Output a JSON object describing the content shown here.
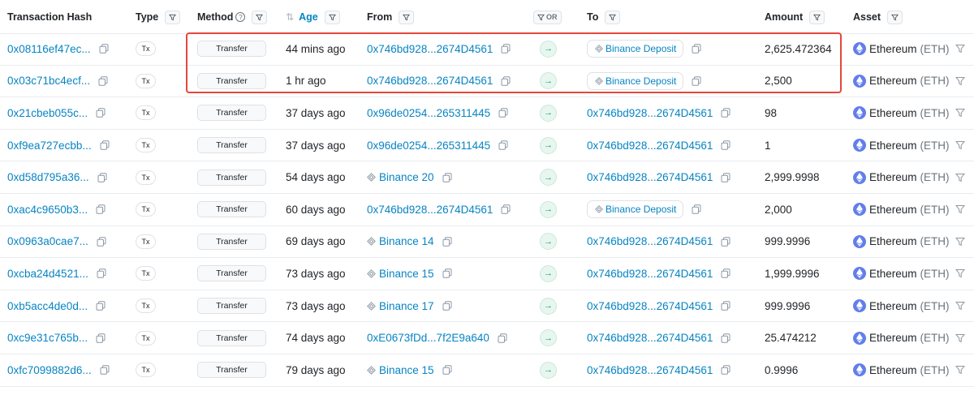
{
  "headers": {
    "hash": "Transaction Hash",
    "type": "Type",
    "method": "Method",
    "age": "Age",
    "from": "From",
    "or": "OR",
    "to": "To",
    "amount": "Amount",
    "asset": "Asset"
  },
  "colors": {
    "link": "#0784c3",
    "highlight_border": "#e5473b",
    "direction_badge": "#00a186",
    "eth": "#627eea"
  },
  "rows": [
    {
      "hash": "0x08116ef47ec...",
      "type": "Tx",
      "method": "Transfer",
      "age": "44 mins ago",
      "from": "0x746bd928...2674D4561",
      "from_kind": "address",
      "to": "Binance Deposit",
      "to_kind": "deposit",
      "amount": "2,625.472364",
      "asset_name": "Ethereum",
      "asset_symbol": "(ETH)"
    },
    {
      "hash": "0x03c71bc4ecf...",
      "type": "Tx",
      "method": "Transfer",
      "age": "1 hr ago",
      "from": "0x746bd928...2674D4561",
      "from_kind": "address",
      "to": "Binance Deposit",
      "to_kind": "deposit",
      "amount": "2,500",
      "asset_name": "Ethereum",
      "asset_symbol": "(ETH)"
    },
    {
      "hash": "0x21cbeb055c...",
      "type": "Tx",
      "method": "Transfer",
      "age": "37 days ago",
      "from": "0x96de0254...265311445",
      "from_kind": "address",
      "to": "0x746bd928...2674D4561",
      "to_kind": "address",
      "amount": "98",
      "asset_name": "Ethereum",
      "asset_symbol": "(ETH)"
    },
    {
      "hash": "0xf9ea727ecbb...",
      "type": "Tx",
      "method": "Transfer",
      "age": "37 days ago",
      "from": "0x96de0254...265311445",
      "from_kind": "address",
      "to": "0x746bd928...2674D4561",
      "to_kind": "address",
      "amount": "1",
      "asset_name": "Ethereum",
      "asset_symbol": "(ETH)"
    },
    {
      "hash": "0xd58d795a36...",
      "type": "Tx",
      "method": "Transfer",
      "age": "54 days ago",
      "from": "Binance 20",
      "from_kind": "entity",
      "to": "0x746bd928...2674D4561",
      "to_kind": "address",
      "amount": "2,999.9998",
      "asset_name": "Ethereum",
      "asset_symbol": "(ETH)"
    },
    {
      "hash": "0xac4c9650b3...",
      "type": "Tx",
      "method": "Transfer",
      "age": "60 days ago",
      "from": "0x746bd928...2674D4561",
      "from_kind": "address",
      "to": "Binance Deposit",
      "to_kind": "deposit",
      "amount": "2,000",
      "asset_name": "Ethereum",
      "asset_symbol": "(ETH)"
    },
    {
      "hash": "0x0963a0cae7...",
      "type": "Tx",
      "method": "Transfer",
      "age": "69 days ago",
      "from": "Binance 14",
      "from_kind": "entity",
      "to": "0x746bd928...2674D4561",
      "to_kind": "address",
      "amount": "999.9996",
      "asset_name": "Ethereum",
      "asset_symbol": "(ETH)"
    },
    {
      "hash": "0xcba24d4521...",
      "type": "Tx",
      "method": "Transfer",
      "age": "73 days ago",
      "from": "Binance 15",
      "from_kind": "entity",
      "to": "0x746bd928...2674D4561",
      "to_kind": "address",
      "amount": "1,999.9996",
      "asset_name": "Ethereum",
      "asset_symbol": "(ETH)"
    },
    {
      "hash": "0xb5acc4de0d...",
      "type": "Tx",
      "method": "Transfer",
      "age": "73 days ago",
      "from": "Binance 17",
      "from_kind": "entity",
      "to": "0x746bd928...2674D4561",
      "to_kind": "address",
      "amount": "999.9996",
      "asset_name": "Ethereum",
      "asset_symbol": "(ETH)"
    },
    {
      "hash": "0xc9e31c765b...",
      "type": "Tx",
      "method": "Transfer",
      "age": "74 days ago",
      "from": "0xE0673fDd...7f2E9a640",
      "from_kind": "address",
      "to": "0x746bd928...2674D4561",
      "to_kind": "address",
      "amount": "25.474212",
      "asset_name": "Ethereum",
      "asset_symbol": "(ETH)"
    },
    {
      "hash": "0xfc7099882d6...",
      "type": "Tx",
      "method": "Transfer",
      "age": "79 days ago",
      "from": "Binance 15",
      "from_kind": "entity",
      "to": "0x746bd928...2674D4561",
      "to_kind": "address",
      "amount": "0.9996",
      "asset_name": "Ethereum",
      "asset_symbol": "(ETH)"
    }
  ]
}
